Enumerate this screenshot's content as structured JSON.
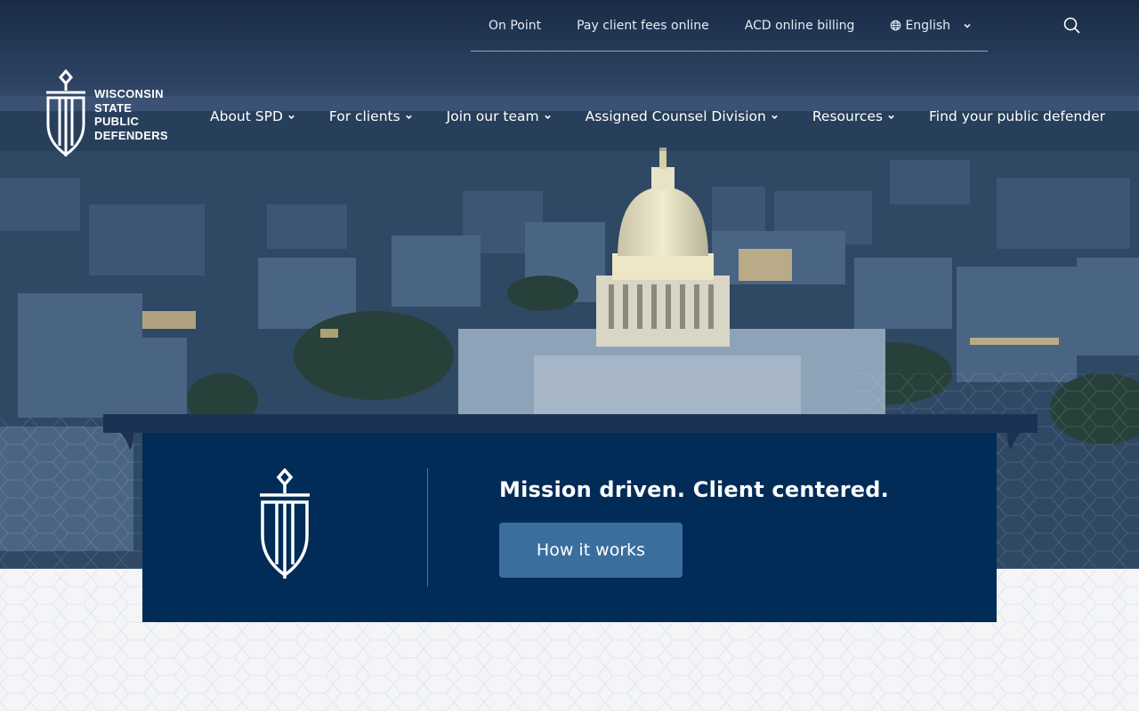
{
  "utility_nav": {
    "items": [
      "On Point",
      "Pay client fees online",
      "ACD online billing"
    ],
    "language": "English"
  },
  "logo": {
    "lines": [
      "WISCONSIN",
      "STATE",
      "PUBLIC",
      "DEFENDERS"
    ]
  },
  "main_nav": {
    "items": [
      {
        "label": "About SPD",
        "dropdown": true
      },
      {
        "label": "For clients",
        "dropdown": true
      },
      {
        "label": "Join our team",
        "dropdown": true
      },
      {
        "label": "Assigned Counsel Division",
        "dropdown": true
      },
      {
        "label": "Resources",
        "dropdown": true
      },
      {
        "label": "Find your public defender",
        "dropdown": false
      }
    ]
  },
  "mission": {
    "title": "Mission driven. Client centered.",
    "button_label": "How it works"
  },
  "colors": {
    "navy": "#012c57",
    "button": "#3a6e9d",
    "band": "#1b3255"
  },
  "icons": {
    "search": "search-icon",
    "globe": "globe-icon",
    "chevron": "chevron-down-icon"
  }
}
